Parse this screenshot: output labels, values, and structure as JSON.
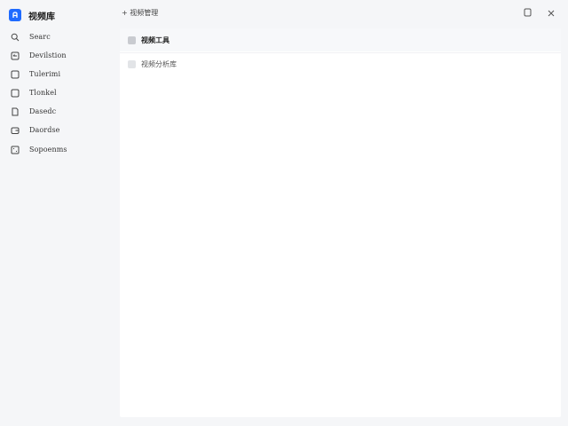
{
  "app": {
    "name": "视频库",
    "logo_letter": "A",
    "accent": "#1f6bff"
  },
  "sidebar": {
    "items": [
      {
        "label": "Searc",
        "icon": "search-icon"
      },
      {
        "label": "Devilstion",
        "icon": "video-icon"
      },
      {
        "label": "Tulerimi",
        "icon": "square-icon"
      },
      {
        "label": "Tlonkel",
        "icon": "square-icon"
      },
      {
        "label": "Dasedc",
        "icon": "file-icon"
      },
      {
        "label": "Daordse",
        "icon": "wallet-icon"
      },
      {
        "label": "Sopoenms",
        "icon": "grid-icon"
      }
    ]
  },
  "topbar": {
    "breadcrumb": "+ 视频管理",
    "actions": [
      "window-icon",
      "close-icon"
    ]
  },
  "list": {
    "rows": [
      {
        "label": "视频工具",
        "selected": true
      },
      {
        "label": "视频分析库",
        "selected": false
      }
    ]
  }
}
